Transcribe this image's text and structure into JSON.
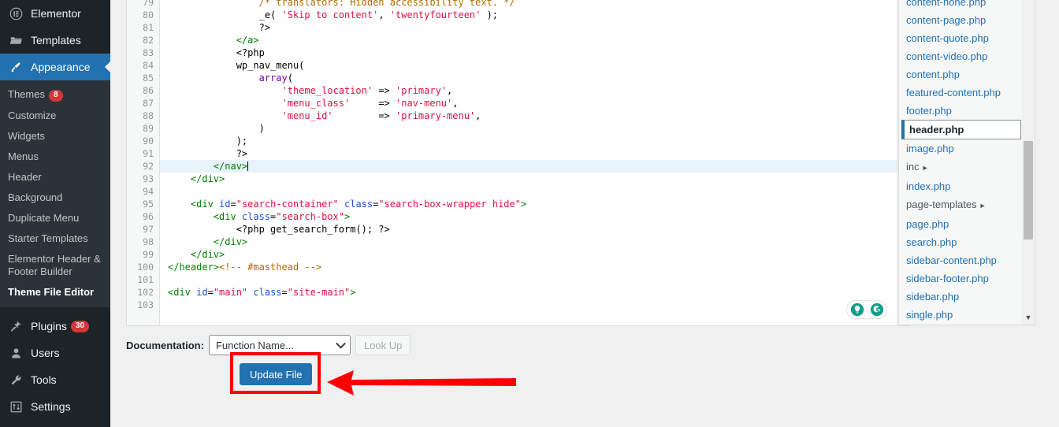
{
  "sidebar": {
    "top_items": [
      {
        "label": "Elementor",
        "icon": "elementor-icon",
        "current": false
      },
      {
        "label": "Templates",
        "icon": "folder-icon",
        "current": false
      },
      {
        "label": "Appearance",
        "icon": "paintbrush-icon",
        "current": true
      }
    ],
    "appearance_submenu": [
      {
        "label": "Themes",
        "badge": "8",
        "current": false
      },
      {
        "label": "Customize",
        "badge": "",
        "current": false
      },
      {
        "label": "Widgets",
        "badge": "",
        "current": false
      },
      {
        "label": "Menus",
        "badge": "",
        "current": false
      },
      {
        "label": "Header",
        "badge": "",
        "current": false
      },
      {
        "label": "Background",
        "badge": "",
        "current": false
      },
      {
        "label": "Duplicate Menu",
        "badge": "",
        "current": false
      },
      {
        "label": "Starter Templates",
        "badge": "",
        "current": false
      },
      {
        "label": "Elementor Header & Footer Builder",
        "badge": "",
        "current": false
      },
      {
        "label": "Theme File Editor",
        "badge": "",
        "current": true
      }
    ],
    "bottom_items": [
      {
        "label": "Plugins",
        "icon": "plug-icon",
        "badge": "30"
      },
      {
        "label": "Users",
        "icon": "user-icon",
        "badge": ""
      },
      {
        "label": "Tools",
        "icon": "wrench-icon",
        "badge": ""
      },
      {
        "label": "Settings",
        "icon": "sliders-icon",
        "badge": ""
      }
    ]
  },
  "editor": {
    "first_line_number": 79,
    "active_line_number": 92,
    "lines": [
      {
        "n": 79,
        "tokens": [
          {
            "t": "com",
            "s": "                /* translators: Hidden accessibility text. */"
          }
        ]
      },
      {
        "n": 80,
        "tokens": [
          {
            "t": "def",
            "s": "                _e( "
          },
          {
            "t": "str",
            "s": "'Skip to content'"
          },
          {
            "t": "def",
            "s": ", "
          },
          {
            "t": "str",
            "s": "'twentyfourteen'"
          },
          {
            "t": "def",
            "s": " );"
          }
        ]
      },
      {
        "n": 81,
        "tokens": [
          {
            "t": "def",
            "s": "                ?>"
          }
        ]
      },
      {
        "n": 82,
        "tokens": [
          {
            "t": "tag",
            "s": "            </a>"
          }
        ]
      },
      {
        "n": 83,
        "tokens": [
          {
            "t": "def",
            "s": "            <?php"
          }
        ]
      },
      {
        "n": 84,
        "tokens": [
          {
            "t": "def",
            "s": "            wp_nav_menu("
          }
        ]
      },
      {
        "n": 85,
        "tokens": [
          {
            "t": "def",
            "s": "                "
          },
          {
            "t": "kw",
            "s": "array"
          },
          {
            "t": "def",
            "s": "("
          }
        ]
      },
      {
        "n": 86,
        "tokens": [
          {
            "t": "def",
            "s": "                    "
          },
          {
            "t": "str",
            "s": "'theme_location'"
          },
          {
            "t": "def",
            "s": " => "
          },
          {
            "t": "str",
            "s": "'primary'"
          },
          {
            "t": "def",
            "s": ","
          }
        ]
      },
      {
        "n": 87,
        "tokens": [
          {
            "t": "def",
            "s": "                    "
          },
          {
            "t": "str",
            "s": "'menu_class'"
          },
          {
            "t": "def",
            "s": "     => "
          },
          {
            "t": "str",
            "s": "'nav-menu'"
          },
          {
            "t": "def",
            "s": ","
          }
        ]
      },
      {
        "n": 88,
        "tokens": [
          {
            "t": "def",
            "s": "                    "
          },
          {
            "t": "str",
            "s": "'menu_id'"
          },
          {
            "t": "def",
            "s": "        => "
          },
          {
            "t": "str",
            "s": "'primary-menu'"
          },
          {
            "t": "def",
            "s": ","
          }
        ]
      },
      {
        "n": 89,
        "tokens": [
          {
            "t": "def",
            "s": "                )"
          }
        ]
      },
      {
        "n": 90,
        "tokens": [
          {
            "t": "def",
            "s": "            );"
          }
        ]
      },
      {
        "n": 91,
        "tokens": [
          {
            "t": "def",
            "s": "            ?>"
          }
        ]
      },
      {
        "n": 92,
        "tokens": [
          {
            "t": "tag",
            "s": "        </nav>"
          }
        ],
        "active": true,
        "caret": true
      },
      {
        "n": 93,
        "tokens": [
          {
            "t": "tag",
            "s": "    </div>"
          }
        ]
      },
      {
        "n": 94,
        "tokens": [
          {
            "t": "def",
            "s": ""
          }
        ]
      },
      {
        "n": 95,
        "tokens": [
          {
            "t": "tag",
            "s": "    <div "
          },
          {
            "t": "atr",
            "s": "id"
          },
          {
            "t": "def",
            "s": "="
          },
          {
            "t": "val",
            "s": "\"search-container\""
          },
          {
            "t": "def",
            "s": " "
          },
          {
            "t": "atr",
            "s": "class"
          },
          {
            "t": "def",
            "s": "="
          },
          {
            "t": "val",
            "s": "\"search-box-wrapper hide\""
          },
          {
            "t": "tag",
            "s": ">"
          }
        ]
      },
      {
        "n": 96,
        "tokens": [
          {
            "t": "tag",
            "s": "        <div "
          },
          {
            "t": "atr",
            "s": "class"
          },
          {
            "t": "def",
            "s": "="
          },
          {
            "t": "val",
            "s": "\"search-box\""
          },
          {
            "t": "tag",
            "s": ">"
          }
        ]
      },
      {
        "n": 97,
        "tokens": [
          {
            "t": "def",
            "s": "            <?php get_search_form(); ?>"
          }
        ]
      },
      {
        "n": 98,
        "tokens": [
          {
            "t": "tag",
            "s": "        </div>"
          }
        ]
      },
      {
        "n": 99,
        "tokens": [
          {
            "t": "tag",
            "s": "    </div>"
          }
        ]
      },
      {
        "n": 100,
        "tokens": [
          {
            "t": "tag",
            "s": "</header>"
          },
          {
            "t": "com",
            "s": "<!-- #masthead -->"
          }
        ]
      },
      {
        "n": 101,
        "tokens": [
          {
            "t": "def",
            "s": ""
          }
        ]
      },
      {
        "n": 102,
        "tokens": [
          {
            "t": "tag",
            "s": "<div "
          },
          {
            "t": "atr",
            "s": "id"
          },
          {
            "t": "def",
            "s": "="
          },
          {
            "t": "val",
            "s": "\"main\""
          },
          {
            "t": "def",
            "s": " "
          },
          {
            "t": "atr",
            "s": "class"
          },
          {
            "t": "def",
            "s": "="
          },
          {
            "t": "val",
            "s": "\"site-main\""
          },
          {
            "t": "tag",
            "s": ">"
          }
        ]
      },
      {
        "n": 103,
        "tokens": [
          {
            "t": "def",
            "s": ""
          }
        ]
      }
    ]
  },
  "file_list": [
    {
      "name": "content-none.php",
      "type": "file",
      "current": false
    },
    {
      "name": "content-page.php",
      "type": "file",
      "current": false
    },
    {
      "name": "content-quote.php",
      "type": "file",
      "current": false
    },
    {
      "name": "content-video.php",
      "type": "file",
      "current": false
    },
    {
      "name": "content.php",
      "type": "file",
      "current": false
    },
    {
      "name": "featured-content.php",
      "type": "file",
      "current": false
    },
    {
      "name": "footer.php",
      "type": "file",
      "current": false
    },
    {
      "name": "header.php",
      "type": "file",
      "current": true
    },
    {
      "name": "image.php",
      "type": "file",
      "current": false
    },
    {
      "name": "inc",
      "type": "folder",
      "current": false
    },
    {
      "name": "index.php",
      "type": "file",
      "current": false
    },
    {
      "name": "page-templates",
      "type": "folder",
      "current": false
    },
    {
      "name": "page.php",
      "type": "file",
      "current": false
    },
    {
      "name": "search.php",
      "type": "file",
      "current": false
    },
    {
      "name": "sidebar-content.php",
      "type": "file",
      "current": false
    },
    {
      "name": "sidebar-footer.php",
      "type": "file",
      "current": false
    },
    {
      "name": "sidebar.php",
      "type": "file",
      "current": false
    },
    {
      "name": "single.php",
      "type": "file",
      "current": false
    }
  ],
  "documentation": {
    "label": "Documentation:",
    "select_value": "Function Name...",
    "lookup_label": "Look Up"
  },
  "actions": {
    "update_label": "Update File"
  },
  "annotation": {
    "highlight_color": "#ff0000",
    "arrow_color": "#ff0000"
  },
  "grammarly": {
    "bulb_icon": "lightbulb-icon",
    "logo_icon": "grammarly-g-icon",
    "accent": "#0f9d8c"
  },
  "colors": {
    "admin_bg": "#1d2327",
    "submenu_bg": "#2c3338",
    "accent_blue": "#2271b1",
    "badge_red": "#d63638",
    "page_bg": "#f0f0f1"
  }
}
